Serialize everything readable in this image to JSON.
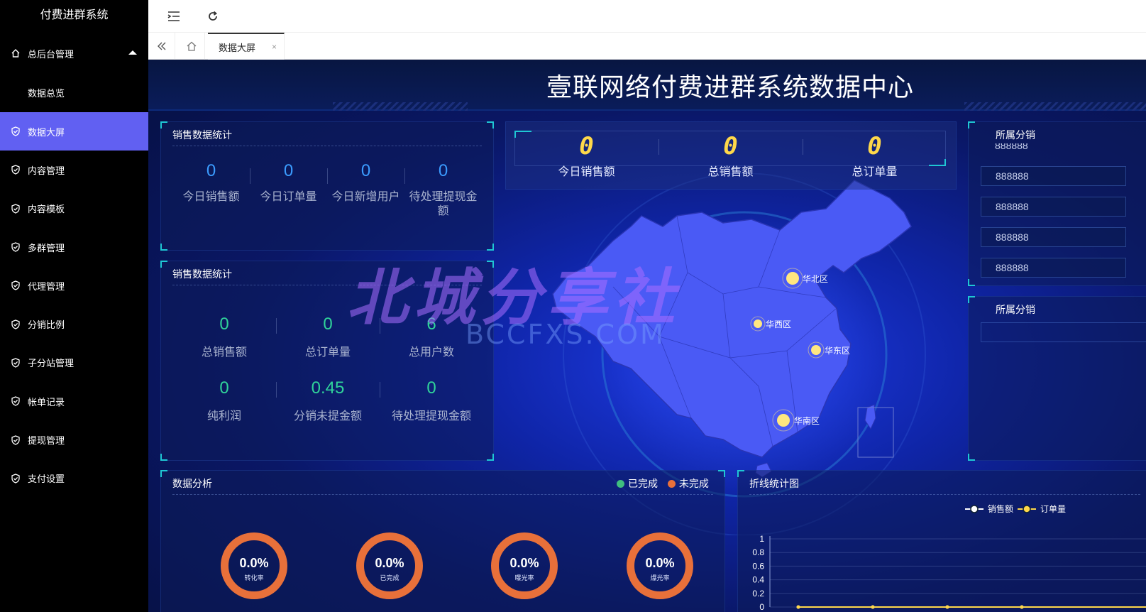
{
  "sidebar": {
    "brand": "付费进群系统",
    "group": {
      "label": "总后台管理",
      "sub": "数据总览"
    },
    "items": [
      {
        "label": "数据大屏",
        "active": true
      },
      {
        "label": "内容管理"
      },
      {
        "label": "内容模板"
      },
      {
        "label": "多群管理"
      },
      {
        "label": "代理管理"
      },
      {
        "label": "分销比例"
      },
      {
        "label": "子分站管理"
      },
      {
        "label": "帐单记录"
      },
      {
        "label": "提现管理"
      },
      {
        "label": "支付设置"
      }
    ]
  },
  "tabs": {
    "active_label": "数据大屏",
    "close": "×"
  },
  "dashboard": {
    "title": "壹联网络付费进群系统数据中心",
    "panel1": {
      "title": "销售数据统计",
      "stats": [
        {
          "value": "0",
          "label": "今日销售额"
        },
        {
          "value": "0",
          "label": "今日订单量"
        },
        {
          "value": "0",
          "label": "今日新增用户"
        },
        {
          "value": "0",
          "label": "待处理提现金额"
        }
      ]
    },
    "panel2": {
      "title": "销售数据统计",
      "stats": [
        {
          "value": "0",
          "label": "总销售额"
        },
        {
          "value": "0",
          "label": "总订单量"
        },
        {
          "value": "6",
          "label": "总用户数"
        },
        {
          "value": "0",
          "label": "纯利润"
        },
        {
          "value": "0.45",
          "label": "分销未提金额"
        },
        {
          "value": "0",
          "label": "待处理提现金额"
        }
      ]
    },
    "kpis": [
      {
        "value": "0",
        "label": "今日销售额"
      },
      {
        "value": "0",
        "label": "总销售额"
      },
      {
        "value": "0",
        "label": "总订单量"
      }
    ],
    "map_regions": [
      {
        "label": "华北区"
      },
      {
        "label": "华西区"
      },
      {
        "label": "华东区"
      },
      {
        "label": "华南区"
      }
    ],
    "right_panel1": {
      "title": "所属分销",
      "partial": "888888",
      "items": [
        "888888",
        "888888",
        "888888",
        "888888"
      ]
    },
    "right_panel2": {
      "title": "所属分销"
    },
    "analysis": {
      "title": "数据分析",
      "legend": [
        {
          "label": "已完成",
          "color": "#3fbf7f"
        },
        {
          "label": "未完成",
          "color": "#e8703a"
        }
      ],
      "donuts": [
        {
          "value": "0.0%",
          "label": "转化率"
        },
        {
          "value": "0.0%",
          "label": "已完成"
        },
        {
          "value": "0.0%",
          "label": "曝光率"
        },
        {
          "value": "0.0%",
          "label": "爆光率"
        }
      ]
    },
    "watermark": {
      "main": "北城分享社",
      "sub": "BCCFXS.COM"
    }
  },
  "chart_data": {
    "type": "line",
    "title": "折线统计图",
    "series": [
      {
        "name": "销售额",
        "values": [
          0,
          0,
          0,
          0
        ],
        "color": "#ffffff"
      },
      {
        "name": "订单量",
        "values": [
          0,
          0,
          0,
          0
        ],
        "color": "#ffd84a"
      }
    ],
    "yticks": [
      "1",
      "0.8",
      "0.6",
      "0.4",
      "0.2",
      "0"
    ],
    "ylim": [
      0,
      1
    ],
    "legend_position": "top-right"
  }
}
